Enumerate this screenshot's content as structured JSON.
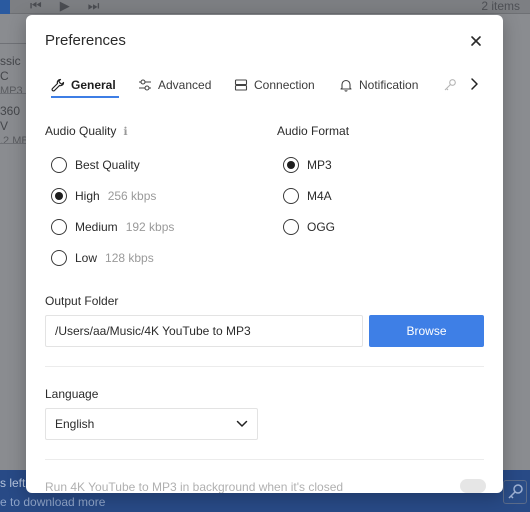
{
  "background": {
    "items_count": "2 items",
    "row1_title": "ssic C",
    "row1_sub": "MP3",
    "row2_title": "360 V",
    "row2_sub": ".2 MB",
    "bottom_line1": "s left",
    "bottom_line2": "e to download more"
  },
  "dialog": {
    "title": "Preferences",
    "tabs": [
      {
        "label": "General",
        "icon": "wrench-icon",
        "active": true
      },
      {
        "label": "Advanced",
        "icon": "sliders-icon",
        "active": false
      },
      {
        "label": "Connection",
        "icon": "server-icon",
        "active": false
      },
      {
        "label": "Notification",
        "icon": "bell-icon",
        "active": false
      }
    ]
  },
  "audio_quality": {
    "label": "Audio Quality",
    "info_icon": "ℹ",
    "options": [
      {
        "label": "Best Quality",
        "detail": "",
        "selected": false
      },
      {
        "label": "High",
        "detail": "256 kbps",
        "selected": true
      },
      {
        "label": "Medium",
        "detail": "192 kbps",
        "selected": false
      },
      {
        "label": "Low",
        "detail": "128 kbps",
        "selected": false
      }
    ]
  },
  "audio_format": {
    "label": "Audio Format",
    "options": [
      {
        "label": "MP3",
        "selected": true
      },
      {
        "label": "M4A",
        "selected": false
      },
      {
        "label": "OGG",
        "selected": false
      }
    ]
  },
  "output_folder": {
    "label": "Output Folder",
    "value": "/Users/aa/Music/4K YouTube to MP3",
    "browse_label": "Browse"
  },
  "language": {
    "label": "Language",
    "selected": "English"
  },
  "run_in_background": {
    "label": "Run 4K YouTube to MP3 in background when it's closed",
    "enabled": false
  },
  "colors": {
    "accent": "#3e7fe6",
    "tab_underline": "#3e7ee5"
  }
}
